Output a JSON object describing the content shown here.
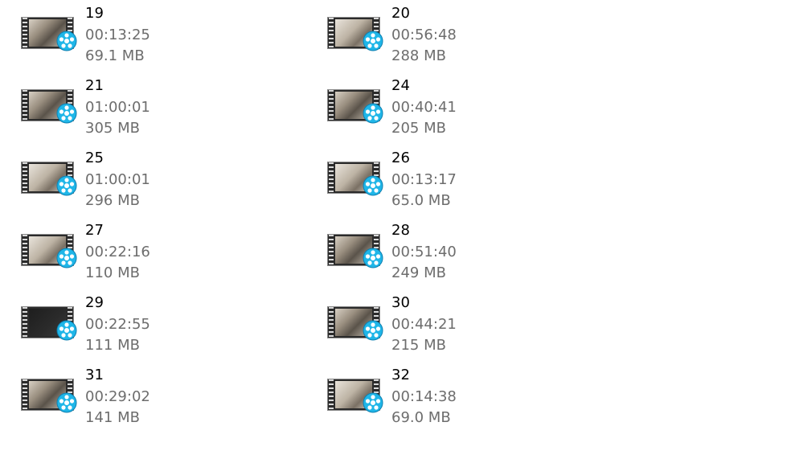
{
  "files": [
    {
      "name": "19",
      "duration": "00:13:25",
      "size": "69.1 MB",
      "thumb": "normal"
    },
    {
      "name": "20",
      "duration": "00:56:48",
      "size": "288 MB",
      "thumb": "light"
    },
    {
      "name": "21",
      "duration": "01:00:01",
      "size": "305 MB",
      "thumb": "normal"
    },
    {
      "name": "24",
      "duration": "00:40:41",
      "size": "205 MB",
      "thumb": "normal"
    },
    {
      "name": "25",
      "duration": "01:00:01",
      "size": "296 MB",
      "thumb": "light"
    },
    {
      "name": "26",
      "duration": "00:13:17",
      "size": "65.0 MB",
      "thumb": "light"
    },
    {
      "name": "27",
      "duration": "00:22:16",
      "size": "110 MB",
      "thumb": "light"
    },
    {
      "name": "28",
      "duration": "00:51:40",
      "size": "249 MB",
      "thumb": "normal"
    },
    {
      "name": "29",
      "duration": "00:22:55",
      "size": "111 MB",
      "thumb": "dark"
    },
    {
      "name": "30",
      "duration": "00:44:21",
      "size": "215 MB",
      "thumb": "normal"
    },
    {
      "name": "31",
      "duration": "00:29:02",
      "size": "141 MB",
      "thumb": "normal"
    },
    {
      "name": "32",
      "duration": "00:14:38",
      "size": "69.0 MB",
      "thumb": "light"
    }
  ],
  "icon": "video-file-icon",
  "colors": {
    "name_text": "#000000",
    "meta_text": "#6d6d6d",
    "reel_accent": "#1fb6e8"
  }
}
